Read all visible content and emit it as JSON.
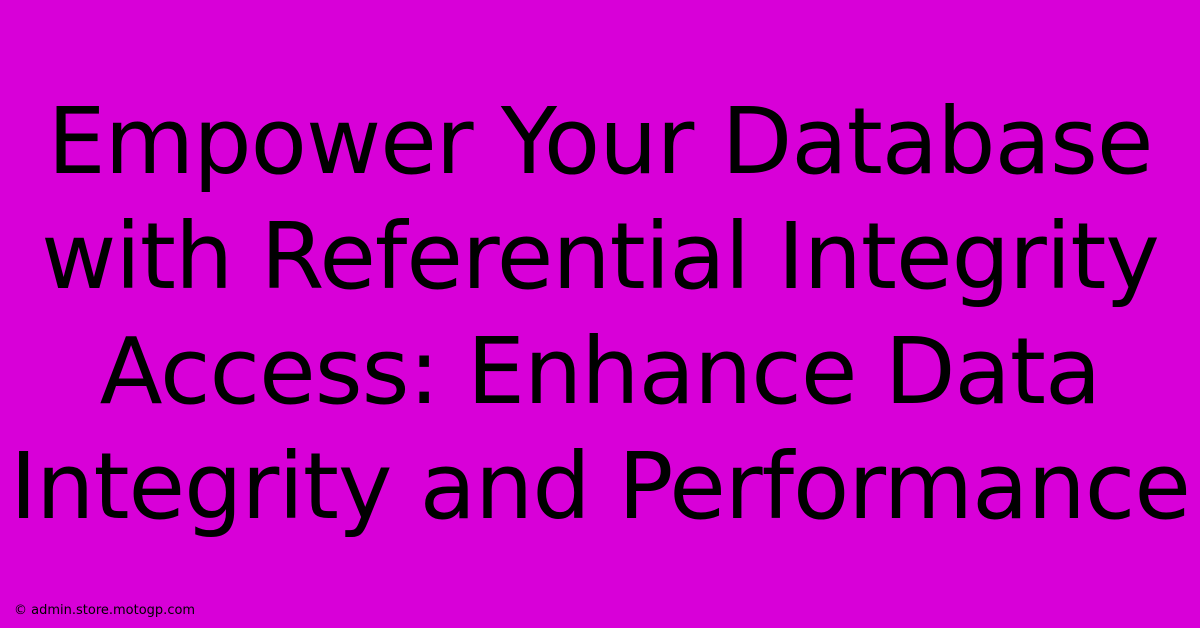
{
  "banner": {
    "headline": "Empower Your Database with Referential Integrity Access: Enhance Data Integrity and Performance",
    "copyright": "© admin.store.motogp.com"
  },
  "colors": {
    "background": "#d800d8",
    "text": "#000000"
  }
}
